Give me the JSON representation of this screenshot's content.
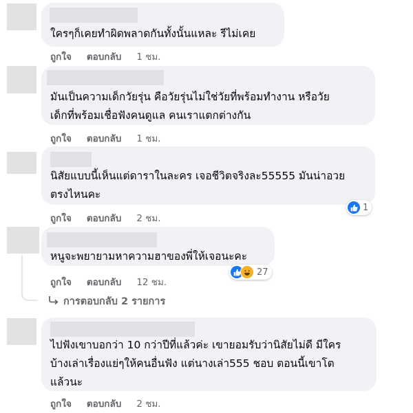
{
  "comments": [
    {
      "text_lines": [
        "ใครๆก็เคยทำผิดพลาดกันทั้งนั้นแหละ รีไม่เคย"
      ],
      "like": "ถูกใจ",
      "reply": "ตอบกลับ",
      "time": "1 ชม."
    },
    {
      "text_lines": [
        "มันเป็นความเด็กวัยรุ่น คือวัยรุ่นไม่ใช่วัยที่พร้อมทำงาน หรือวัย",
        "เด็กที่พร้อมเชื่อฟังคนดูแล คนเราแตกต่างกัน"
      ],
      "like": "ถูกใจ",
      "reply": "ตอบกลับ",
      "time": "1 ชม."
    },
    {
      "text_lines": [
        "นิสัยแบบนี้เห็นแต่ดาราในละคร เจอชีวิตจริงละ55555 มันน่าอวย",
        "ตรงไหนคะ"
      ],
      "like": "ถูกใจ",
      "reply": "ตอบกลับ",
      "time": "2 ชม.",
      "reaction_count": "1"
    },
    {
      "text_lines": [
        "หนูจะพยายามหาความฮาของพี่ให้เจอนะคะ"
      ],
      "like": "ถูกใจ",
      "reply": "ตอบกลับ",
      "time": "12 ชม.",
      "reaction_count": "27",
      "replies_label": "การตอบกลับ 2 รายการ"
    },
    {
      "text_lines": [
        "ไปฟังเขาบอกว่า 10 กว่าปีที่แล้วค่ะ เขายอมรับว่านิสัยไม่ดี มีใคร",
        "บ้างเล่าเรื่องแย่ๆให้คนอื่นฟัง แต่นางเล่า555 ชอบ ตอนนี้เขาโต",
        "แล้วนะ"
      ],
      "like": "ถูกใจ",
      "reply": "ตอบกลับ",
      "time": "2 ชม."
    }
  ],
  "colors": {
    "bubble": "#f0f2f5",
    "meta_text": "#65676b",
    "like_blue": "#1877f2",
    "haha_yellow": "#f7b125"
  },
  "icons": {
    "like": "thumbs-up-icon",
    "haha": "laughing-face-icon",
    "reply_arrow": "reply-arrow-icon"
  }
}
